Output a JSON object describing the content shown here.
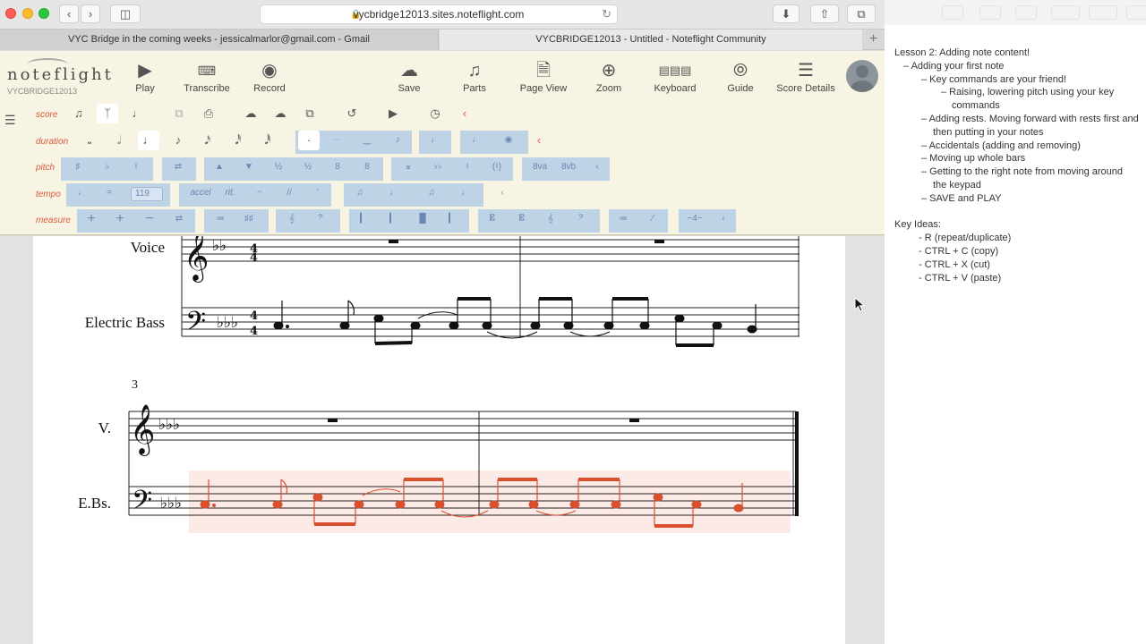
{
  "browser": {
    "url": "vycbridge12013.sites.noteflight.com",
    "tabs": [
      {
        "label": "VYC Bridge in the coming weeks - jessicalmarlor@gmail.com - Gmail"
      },
      {
        "label": "VYCBRIDGE12013 - Untitled - Noteflight Community"
      }
    ]
  },
  "app": {
    "logo": "noteflight",
    "account": "VYCBRIDGE12013",
    "toolbar": [
      {
        "label": "Play",
        "icon": "play-icon"
      },
      {
        "label": "Transcribe",
        "icon": "transcribe-icon"
      },
      {
        "label": "Record",
        "icon": "record-icon"
      },
      {
        "label": "Save",
        "icon": "cloud-save-icon"
      },
      {
        "label": "Parts",
        "icon": "guitar-icon"
      },
      {
        "label": "Page View",
        "icon": "page-icon"
      },
      {
        "label": "Zoom",
        "icon": "zoom-icon"
      },
      {
        "label": "Keyboard",
        "icon": "keyboard-icon"
      },
      {
        "label": "Guide",
        "icon": "compass-icon"
      },
      {
        "label": "Score Details",
        "icon": "list-icon"
      }
    ],
    "palette": {
      "rows": [
        "score",
        "duration",
        "pitch",
        "tempo",
        "measure"
      ],
      "tempo_value": "119"
    }
  },
  "score": {
    "staves": [
      {
        "name": "Voice",
        "abbr": "V."
      },
      {
        "name": "Electric Bass",
        "abbr": "E.Bs."
      }
    ],
    "measure_number": "3",
    "time_signature": "4/4",
    "accent_color": "#d9502e"
  },
  "notes": {
    "lines": [
      {
        "text": "Lesson 2: Adding note content!",
        "indent": 0
      },
      {
        "text": "– Adding your first note",
        "indent": 10
      },
      {
        "text": "– Key commands are your friend!",
        "indent": 30
      },
      {
        "text": "– Raising, lowering pitch using your key",
        "indent": 52
      },
      {
        "text": "commands",
        "indent": 64
      },
      {
        "text": "– Adding rests. Moving forward with rests first and",
        "indent": 30
      },
      {
        "text": "then putting in your notes",
        "indent": 43
      },
      {
        "text": "– Accidentals (adding and removing)",
        "indent": 30
      },
      {
        "text": "– Moving up whole bars",
        "indent": 30
      },
      {
        "text": "– Getting to the right note from moving around",
        "indent": 30
      },
      {
        "text": "the keypad",
        "indent": 43
      },
      {
        "text": "– SAVE and PLAY",
        "indent": 30
      },
      {
        "text": "",
        "indent": 0
      },
      {
        "text": "Key Ideas:",
        "indent": 0
      },
      {
        "text": "- R (repeat/duplicate)",
        "indent": 27
      },
      {
        "text": "- CTRL + C (copy)",
        "indent": 27
      },
      {
        "text": "- CTRL + X (cut)",
        "indent": 27
      },
      {
        "text": "- CTRL + V (paste)",
        "indent": 27
      }
    ]
  }
}
